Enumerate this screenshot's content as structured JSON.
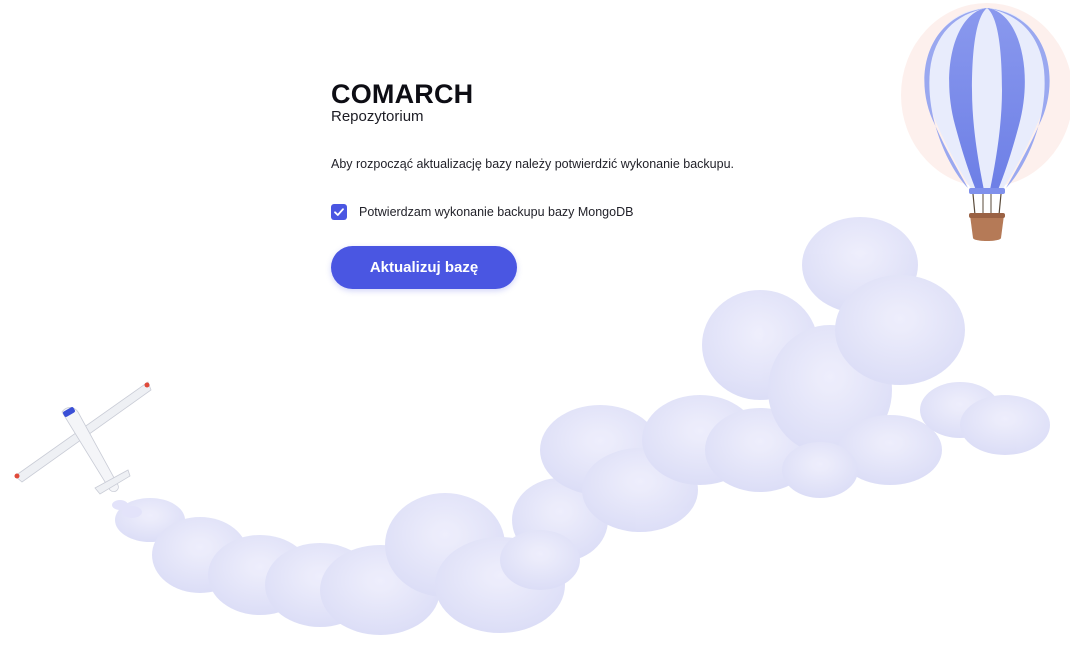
{
  "brand": "COMARCH",
  "subtitle": "Repozytorium",
  "message": "Aby rozpocząć aktualizację bazy należy potwierdzić wykonanie backupu.",
  "backup_confirmation": {
    "label": "Potwierdzam wykonanie backupu bazy MongoDB",
    "checked": true
  },
  "update_button": "Aktualizuj bazę",
  "illustrations": {
    "balloon": "hot-air-balloon-icon",
    "plane": "airplane-icon",
    "clouds": "cloud-trail"
  },
  "colors": {
    "accent": "#4a56e2",
    "cloud": "#e3e3fa",
    "balloon_stripe": "#7f90ec"
  }
}
